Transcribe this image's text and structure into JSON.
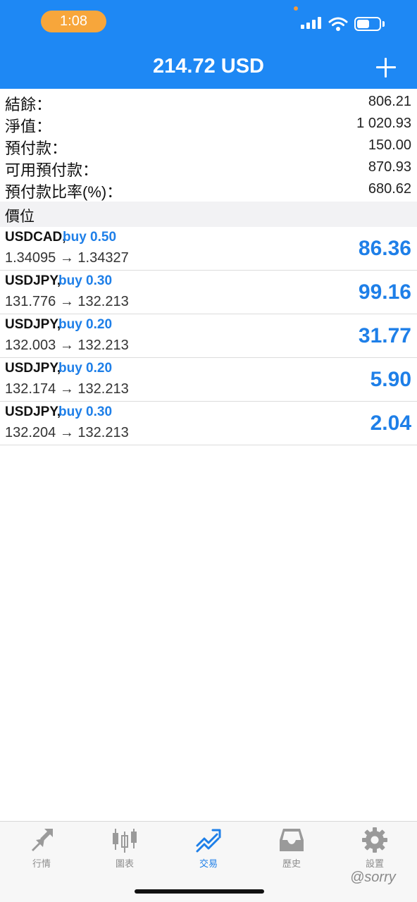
{
  "status_bar": {
    "time": "1:08"
  },
  "header": {
    "title": "214.72 USD"
  },
  "summary": [
    {
      "label": "結餘：",
      "value": "806.21"
    },
    {
      "label": "淨值：",
      "value": "1 020.93"
    },
    {
      "label": "預付款：",
      "value": "150.00"
    },
    {
      "label": "可用預付款：",
      "value": "870.93"
    },
    {
      "label": "預付款比率(%)：",
      "value": "680.62"
    }
  ],
  "positions_section": {
    "title": "價位"
  },
  "positions": [
    {
      "symbol": "USDCAD,",
      "direction": "buy 0.50",
      "prices": "1.34095 → 1.34327",
      "profit": "86.36"
    },
    {
      "symbol": "USDJPY,",
      "direction": "buy 0.30",
      "prices": "131.776 → 132.213",
      "profit": "99.16"
    },
    {
      "symbol": "USDJPY,",
      "direction": "buy 0.20",
      "prices": "132.003 → 132.213",
      "profit": "31.77"
    },
    {
      "symbol": "USDJPY,",
      "direction": "buy 0.20",
      "prices": "132.174 → 132.213",
      "profit": "5.90"
    },
    {
      "symbol": "USDJPY,",
      "direction": "buy 0.30",
      "prices": "132.204 → 132.213",
      "profit": "2.04"
    }
  ],
  "tabs": [
    {
      "label": "行情",
      "icon": "quotes-arrows-icon"
    },
    {
      "label": "圖表",
      "icon": "candlestick-chart-icon"
    },
    {
      "label": "交易",
      "icon": "trade-trend-icon",
      "active": true
    },
    {
      "label": "歷史",
      "icon": "history-inbox-icon"
    },
    {
      "label": "設置",
      "icon": "settings-gear-icon"
    }
  ],
  "watermark": "@sorry",
  "colors": {
    "header": "#1e88f4",
    "accent": "#1e7fe8",
    "time_pill": "#f7a63b"
  }
}
